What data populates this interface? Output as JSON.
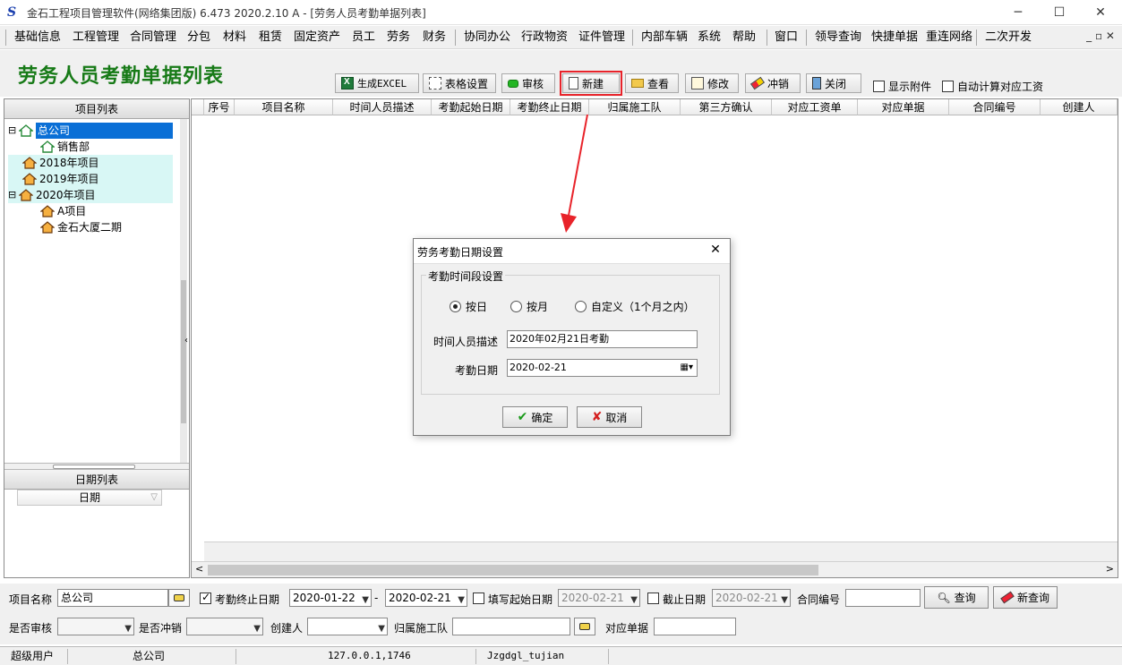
{
  "window": {
    "title": "金石工程项目管理软件(网络集团版) 6.473  2020.2.10 A - [劳务人员考勤单据列表]",
    "minimize_glyph": "─",
    "maximize_glyph": "☐",
    "close_glyph": "✕"
  },
  "menu": {
    "items": [
      "基础信息",
      "工程管理",
      "合同管理",
      "分包",
      "材料",
      "租赁",
      "固定资产",
      "员工",
      "劳务",
      "财务",
      "协同办公",
      "行政物资",
      "证件管理",
      "内部车辆",
      "系统",
      "帮助",
      "窗口",
      "领导查询",
      "快捷单据",
      "重连网络",
      "二次开发"
    ],
    "mdi_controls": "_ ▫ ✕"
  },
  "page": {
    "title": "劳务人员考勤单据列表"
  },
  "toolbar": {
    "excel": "生成EXCEL",
    "grid_settings": "表格设置",
    "approve": "审核",
    "new": "新建",
    "view": "查看",
    "edit": "修改",
    "reverse": "冲销",
    "close": "关闭",
    "show_attachments": "显示附件",
    "auto_calc_wage": "自动计算对应工资"
  },
  "project_panel": {
    "header": "项目列表",
    "tree": [
      {
        "label": "总公司",
        "level": 0,
        "expander": "⊟",
        "selected": true
      },
      {
        "label": "销售部",
        "level": 1,
        "expander": "",
        "selected": false
      },
      {
        "label": "2018年项目",
        "level": 0,
        "expander": "",
        "selected": false
      },
      {
        "label": "2019年项目",
        "level": 0,
        "expander": "",
        "selected": false
      },
      {
        "label": "2020年项目",
        "level": 0,
        "expander": "⊟",
        "selected": false
      },
      {
        "label": "A项目",
        "level": 1,
        "expander": "",
        "selected": false
      },
      {
        "label": "金石大厦二期",
        "level": 1,
        "expander": "",
        "selected": false
      }
    ]
  },
  "date_panel": {
    "header": "日期列表",
    "column": "日期"
  },
  "grid": {
    "columns": [
      "序号",
      "项目名称",
      "时间人员描述",
      "考勤起始日期",
      "考勤终止日期",
      "归属施工队",
      "第三方确认",
      "对应工资单",
      "对应单据",
      "合同编号",
      "创建人"
    ]
  },
  "filters": {
    "project_name_label": "项目名称",
    "project_name_value": "总公司",
    "end_date_label": "考勤终止日期",
    "end_date_from": "2020-01-22",
    "end_date_to": "2020-02-21",
    "range_sep": "-",
    "fill_start_label": "填写起始日期",
    "fill_start_value": "2020-02-21",
    "cutoff_label": "截止日期",
    "cutoff_value": "2020-02-21",
    "contract_no_label": "合同编号",
    "contract_no_value": "",
    "query_button": "查询",
    "new_query_button": "新查询",
    "approved_label": "是否审核",
    "reversed_label": "是否冲销",
    "creator_label": "创建人",
    "team_label": "归属施工队",
    "doc_label": "对应单据"
  },
  "status_bar": {
    "user": "超级用户",
    "company": "总公司",
    "server": "127.0.0.1,1746",
    "database": "Jzgdgl_tujian"
  },
  "dialog": {
    "title": "劳务考勤日期设置",
    "group_title": "考勤时间段设置",
    "radio_by_day": "按日",
    "radio_by_month": "按月",
    "radio_custom": "自定义（1个月之内）",
    "desc_label": "时间人员描述",
    "desc_value": "2020年02月21日考勤",
    "date_label": "考勤日期",
    "date_value": "2020-02-21",
    "ok": "确定",
    "cancel": "取消",
    "close_glyph": "✕"
  },
  "colors": {
    "title_green": "#177a17",
    "highlight_red": "#e8232a",
    "tree_selected": "#0a6fd6",
    "tree_group_bg": "#d8f7f5"
  }
}
